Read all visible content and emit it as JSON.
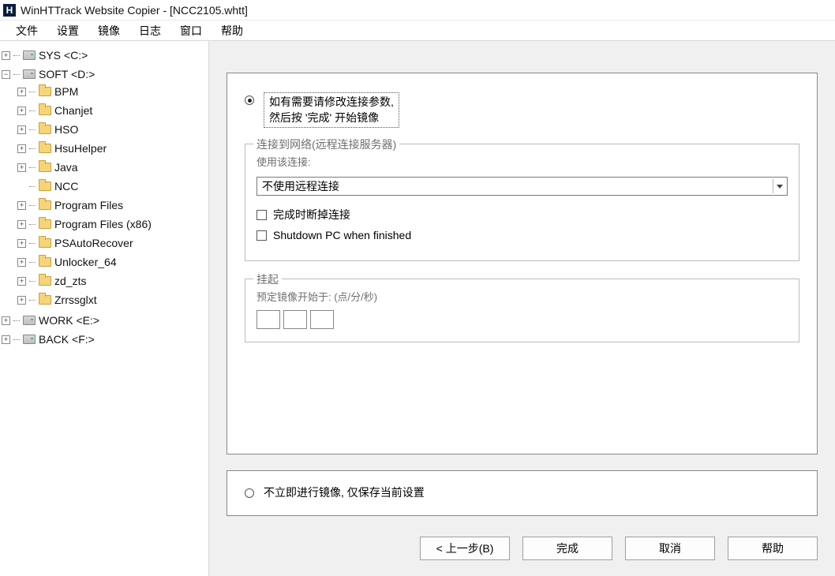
{
  "titlebar": {
    "app_icon_text": "H",
    "title": "WinHTTrack Website Copier - [NCC2105.whtt]"
  },
  "menu": {
    "items": [
      "文件",
      "设置",
      "镜像",
      "日志",
      "窗口",
      "帮助"
    ]
  },
  "tree": {
    "drives": [
      {
        "label": "SYS <C:>",
        "expanded": false,
        "children": []
      },
      {
        "label": "SOFT <D:>",
        "expanded": true,
        "children": [
          {
            "label": "BPM",
            "hasChildren": true
          },
          {
            "label": "Chanjet",
            "hasChildren": true
          },
          {
            "label": "HSO",
            "hasChildren": true
          },
          {
            "label": "HsuHelper",
            "hasChildren": true
          },
          {
            "label": "Java",
            "hasChildren": true
          },
          {
            "label": "NCC",
            "hasChildren": false
          },
          {
            "label": "Program Files",
            "hasChildren": true
          },
          {
            "label": "Program Files (x86)",
            "hasChildren": true
          },
          {
            "label": "PSAutoRecover",
            "hasChildren": true
          },
          {
            "label": "Unlocker_64",
            "hasChildren": true
          },
          {
            "label": "zd_zts",
            "hasChildren": true
          },
          {
            "label": "Zrrssglxt",
            "hasChildren": true
          }
        ]
      },
      {
        "label": "WORK <E:>",
        "expanded": false,
        "children": []
      },
      {
        "label": "BACK <F:>",
        "expanded": false,
        "children": []
      }
    ]
  },
  "wizard": {
    "option_start": {
      "line1": "如有需要请修改连接参数,",
      "line2": "然后按 '完成' 开始镜像",
      "checked": true
    },
    "network_group": {
      "legend": "连接到网络(远程连接服务器)",
      "use_label": "使用该连接:",
      "select_value": "不使用远程连接",
      "disconnect_label": "完成时断掉连接",
      "shutdown_label": "Shutdown PC when finished"
    },
    "suspend_group": {
      "legend": "挂起",
      "schedule_label": "预定镜像开始于: (点/分/秒)"
    },
    "option_save": {
      "label": "不立即进行镜像, 仅保存当前设置",
      "checked": false
    },
    "buttons": {
      "back": "< 上一步(B)",
      "finish": "完成",
      "cancel": "取消",
      "help": "帮助"
    }
  }
}
